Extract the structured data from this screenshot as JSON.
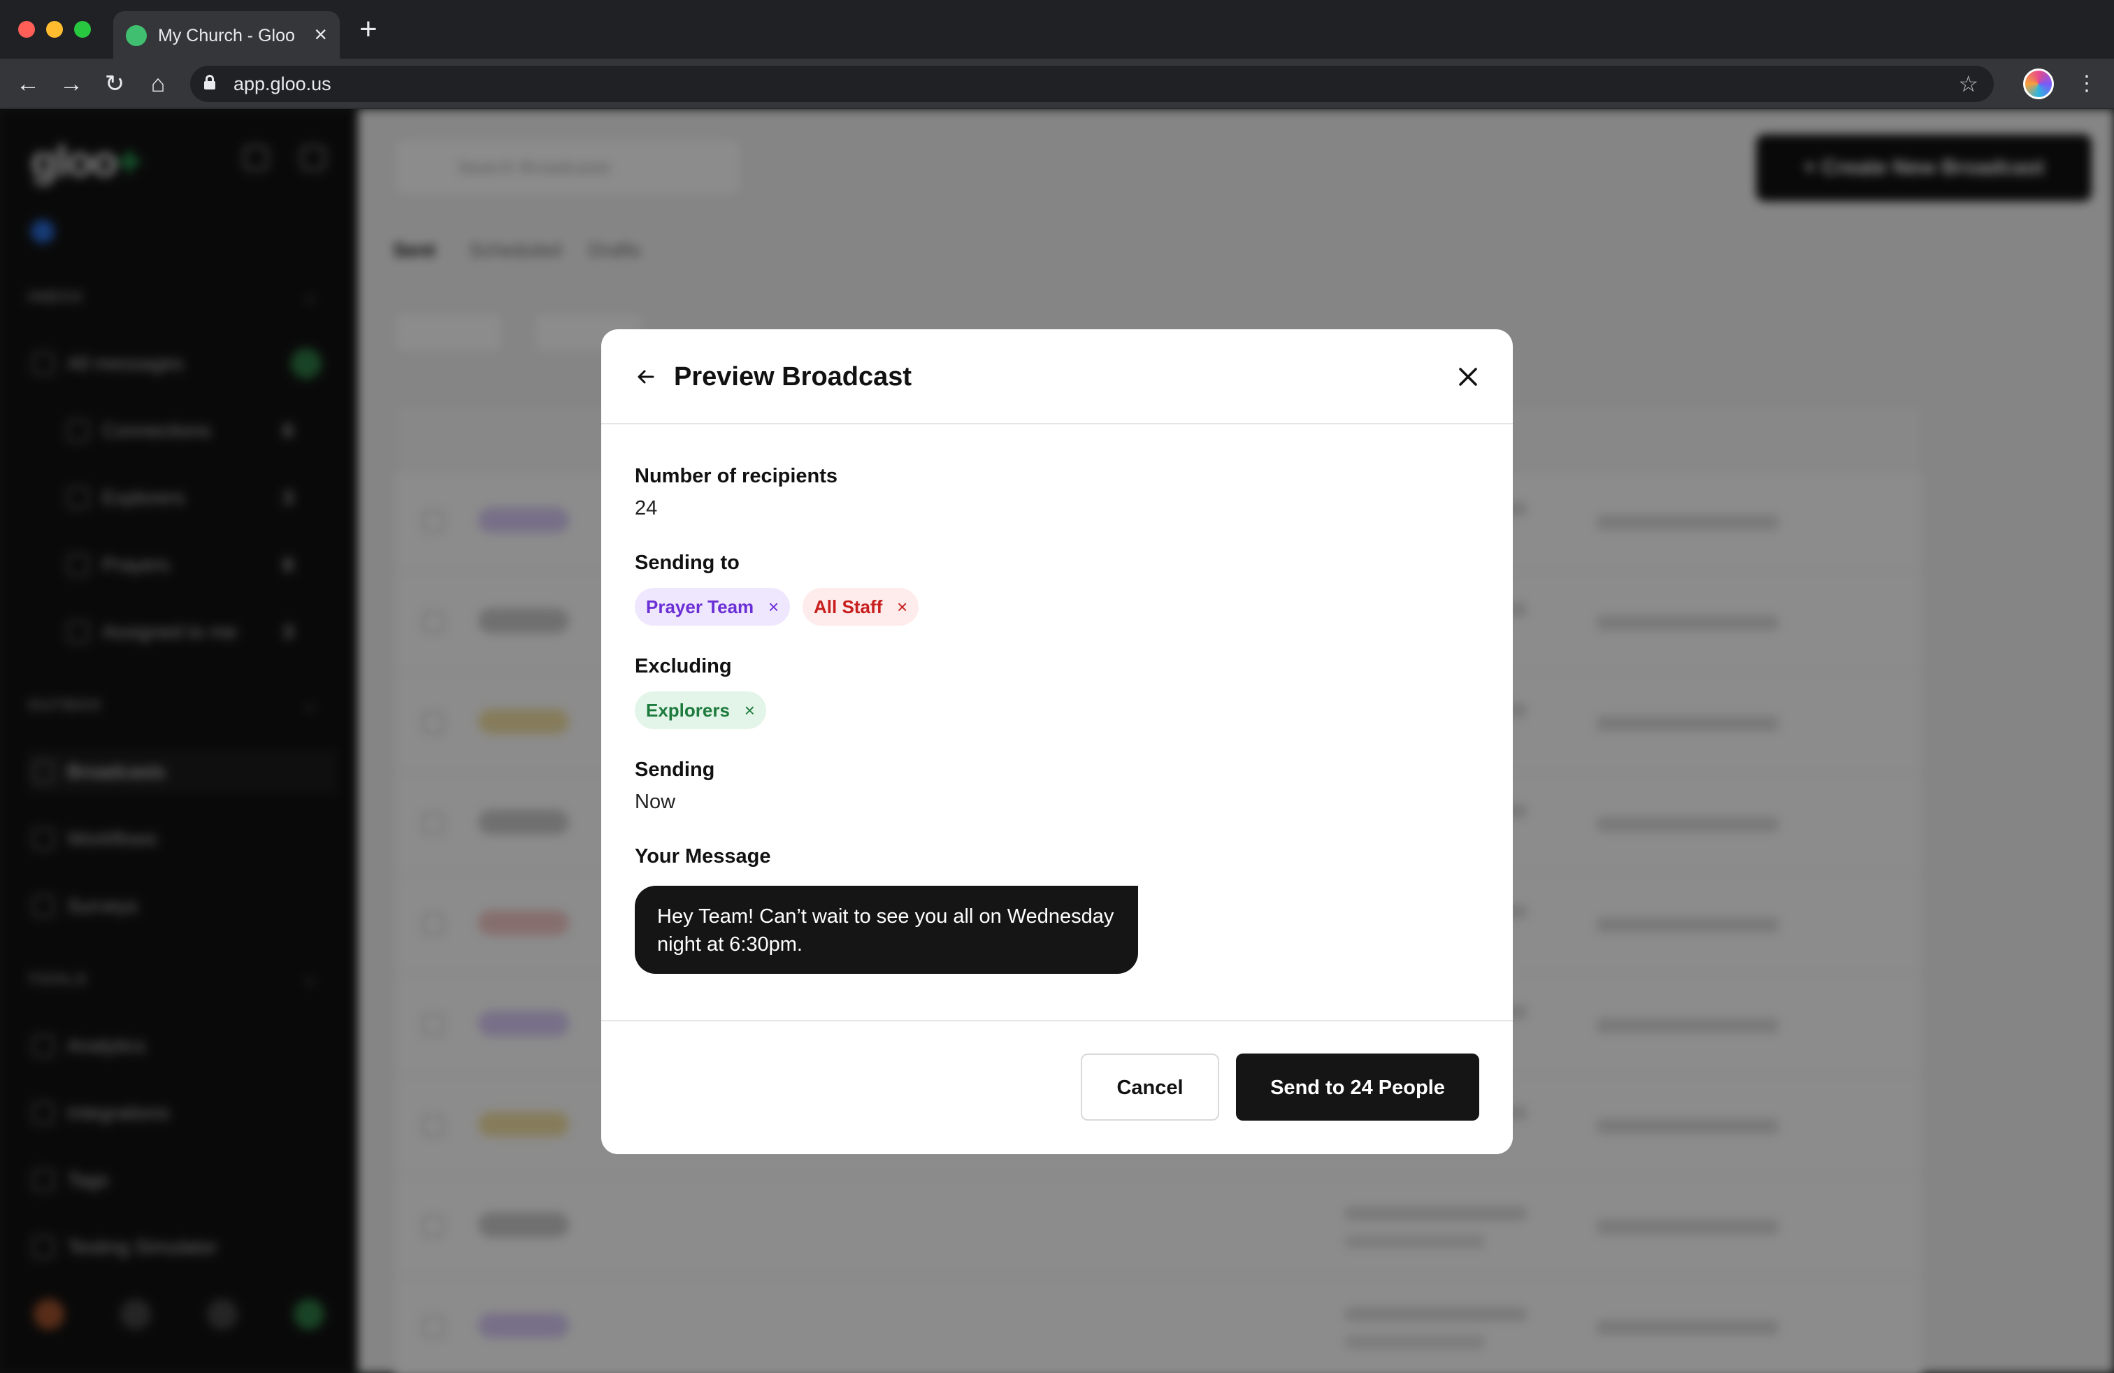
{
  "browser": {
    "tab_title": "My Church - Gloo",
    "tab_close": "×",
    "new_tab": "+",
    "url": "app.gloo.us",
    "back": "←",
    "forward": "→",
    "reload": "↻",
    "home": "⌂",
    "star": "☆",
    "menu": "⋮"
  },
  "modal": {
    "title": "Preview Broadcast",
    "recipients_label": "Number of recipients",
    "recipients_value": "24",
    "sending_to_label": "Sending to",
    "sending_to": [
      {
        "label": "Prayer Team",
        "color": "#6b2fd6"
      },
      {
        "label": "All Staff",
        "color": "#c81e1e"
      }
    ],
    "excluding_label": "Excluding",
    "excluding": [
      {
        "label": "Explorers",
        "color": "#1e7b3e"
      }
    ],
    "chip_remove": "×",
    "sending_label": "Sending",
    "sending_value": "Now",
    "message_label": "Your Message",
    "message_text": "Hey Team! Can’t wait to see you all on Wednesday night at 6:30pm.",
    "cancel_label": "Cancel",
    "send_label": "Send to 24 People"
  }
}
